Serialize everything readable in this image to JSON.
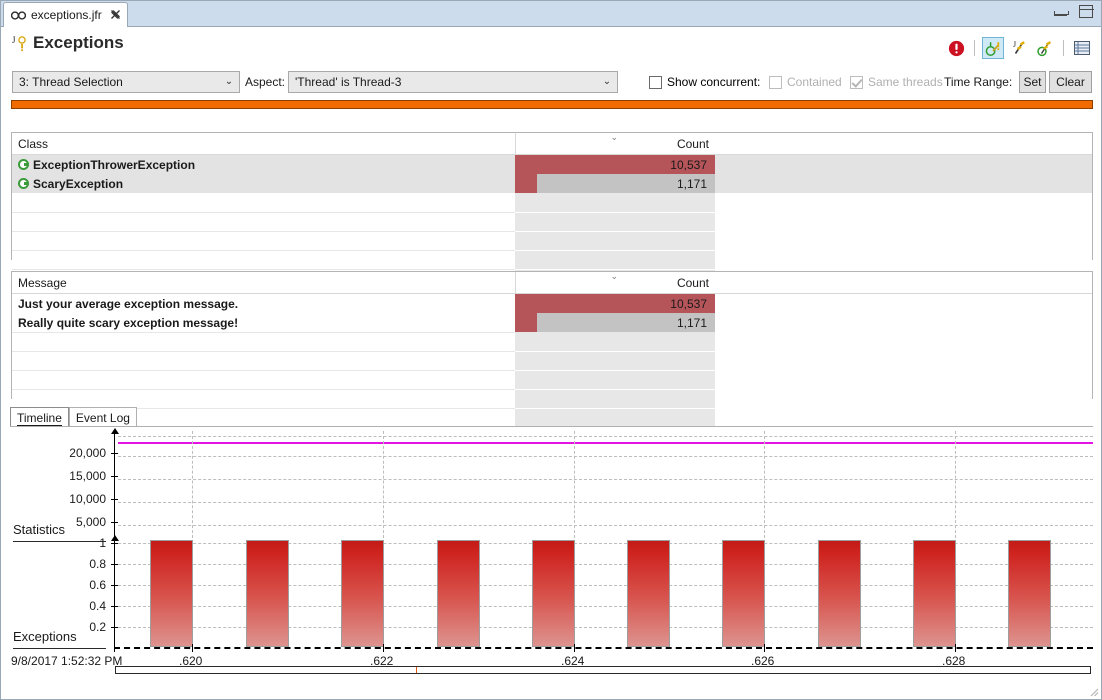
{
  "window": {
    "tab_label": "exceptions.jfr",
    "tab_icon": "binoculars-icon",
    "close_icon": "close-icon",
    "minimize_icon": "minimize-icon",
    "maximize_icon": "maximize-icon"
  },
  "header": {
    "title": "Exceptions",
    "title_icon": "java-exception-icon"
  },
  "toolbar": {
    "icons": [
      {
        "name": "error-icon",
        "glyph": "!",
        "selected": false
      },
      {
        "name": "exception-with-warning-icon",
        "glyph": "J",
        "selected": true
      },
      {
        "name": "exception-thrown-icon",
        "glyph": "J",
        "selected": false
      },
      {
        "name": "exception-caught-icon",
        "glyph": "J",
        "selected": false
      },
      {
        "name": "table-view-icon",
        "glyph": "☰",
        "selected": false
      }
    ]
  },
  "filters": {
    "thread_selection_value": "3: Thread Selection",
    "aspect_label": "Aspect:",
    "aspect_value": "'Thread' is Thread-3",
    "show_concurrent_label": "Show concurrent:",
    "show_concurrent_checked": false,
    "contained_label": "Contained",
    "contained_checked": false,
    "contained_enabled": false,
    "same_threads_label": "Same threads",
    "same_threads_checked": true,
    "same_threads_enabled": false,
    "time_range_label": "Time Range:",
    "set_label": "Set",
    "clear_label": "Clear"
  },
  "class_table": {
    "columns": [
      "Class",
      "Count"
    ],
    "sort_column": "Count",
    "sort_indicator": "⌄",
    "rows": [
      {
        "icon": "class-icon",
        "name": "ExceptionThrowerException",
        "count": "10,537",
        "bar_pct": 100
      },
      {
        "icon": "class-icon",
        "name": "ScaryException",
        "count": "1,171",
        "bar_pct": 11.1
      }
    ]
  },
  "message_table": {
    "columns": [
      "Message",
      "Count"
    ],
    "sort_column": "Count",
    "sort_indicator": "⌄",
    "rows": [
      {
        "name": "Just your average exception message.",
        "count": "10,537",
        "bar_pct": 100
      },
      {
        "name": "Really quite scary exception message!",
        "count": "1,171",
        "bar_pct": 11.1
      }
    ]
  },
  "bottom_tabs": {
    "items": [
      {
        "label": "Timeline",
        "active": true
      },
      {
        "label": "Event Log",
        "active": false
      }
    ]
  },
  "chart_data": {
    "type": "bar",
    "title": "",
    "xlabel": "",
    "lanes": [
      {
        "name": "Statistics",
        "ylabel": "",
        "yticks": [
          "20,000",
          "15,000",
          "10,000",
          "5,000"
        ],
        "ytick_values": [
          20000,
          15000,
          10000,
          5000
        ],
        "ylim": [
          0,
          23000
        ],
        "series": [
          {
            "name": "threshold-line",
            "type": "line",
            "color": "#e313e3",
            "value": 21800
          }
        ]
      },
      {
        "name": "Exceptions",
        "ylabel": "",
        "yticks": [
          "1",
          "0.8",
          "0.6",
          "0.4",
          "0.2"
        ],
        "ytick_values": [
          1,
          0.8,
          0.6,
          0.4,
          0.2
        ],
        "ylim": [
          0,
          1.05
        ],
        "values": [
          1,
          1,
          1,
          1,
          1,
          1,
          1,
          1,
          1,
          1
        ]
      }
    ],
    "xticks": [
      ".620",
      ".622",
      ".624",
      ".628",
      ".628"
    ],
    "xtick_labels": [
      ".620",
      ".622",
      ".624",
      ".626",
      ".628"
    ],
    "start_timestamp": "9/8/2017 1:52:32 PM",
    "grid": true,
    "bar_color": "#cf2420",
    "legend": "none"
  }
}
